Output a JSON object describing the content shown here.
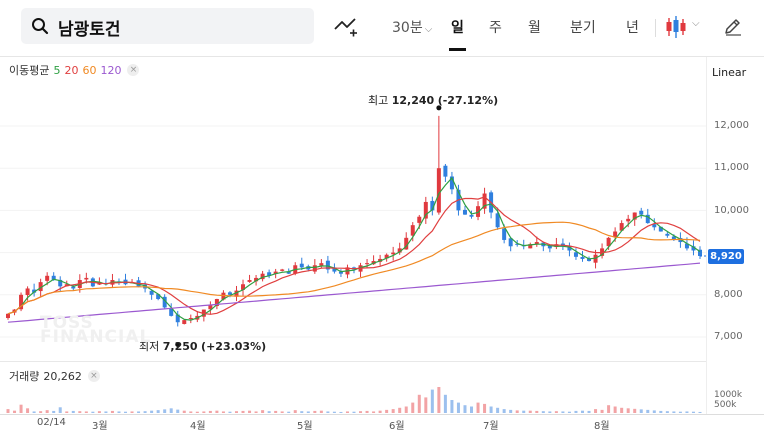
{
  "search": {
    "stock_name": "남광토건"
  },
  "toolbar": {
    "interval": "30분",
    "periods": [
      "일",
      "주",
      "월",
      "분기",
      "년"
    ],
    "active_period": "일"
  },
  "legend": {
    "ma_title": "이동평균",
    "ma_periods": [
      "5",
      "20",
      "60",
      "120"
    ],
    "ma_colors": [
      "#2ea043",
      "#e04040",
      "#f08a24",
      "#9b59d0"
    ],
    "close_symbol": "×",
    "scale": "Linear"
  },
  "colors": {
    "up": "#e0393e",
    "down": "#2f7fde",
    "price_tag": "#1e6fe0"
  },
  "price_axis": [
    "12,000",
    "11,000",
    "10,000",
    "9,000",
    "8,000",
    "7,000"
  ],
  "current_price": "8,920",
  "annotations": {
    "high_label": "최고",
    "high_value": "12,240",
    "high_change": "(-27.12%)",
    "low_label": "최저",
    "low_value": "7,250",
    "low_change": "(+23.03%)"
  },
  "watermark": [
    "TOSS",
    "FINANCIAL"
  ],
  "volume": {
    "title": "거래량",
    "value": "20,262",
    "axis": [
      "1000k",
      "500k"
    ]
  },
  "x_axis": [
    "02/14",
    "3월",
    "4월",
    "5월",
    "6월",
    "7월",
    "8월"
  ],
  "chart_data": {
    "type": "candlestick",
    "title": "남광토건",
    "ylim": [
      6700,
      12800
    ],
    "y_ticks": [
      7000,
      8000,
      9000,
      10000,
      11000,
      12000
    ],
    "high": 12240,
    "low": 7250,
    "current": 8920,
    "volume_last": 20262,
    "closes": [
      7550,
      7650,
      8000,
      8150,
      8050,
      8300,
      8450,
      8350,
      8200,
      8250,
      8150,
      8350,
      8400,
      8200,
      8300,
      8250,
      8350,
      8300,
      8250,
      8300,
      8200,
      8150,
      8000,
      7900,
      7700,
      7500,
      7350,
      7400,
      7450,
      7500,
      7650,
      7750,
      7900,
      8050,
      8000,
      8100,
      8250,
      8350,
      8400,
      8500,
      8450,
      8550,
      8600,
      8500,
      8700,
      8650,
      8600,
      8700,
      8750,
      8600,
      8550,
      8500,
      8650,
      8600,
      8700,
      8750,
      8800,
      8850,
      8950,
      9000,
      9100,
      9350,
      9650,
      9850,
      10200,
      10000,
      11000,
      10800,
      10500,
      10000,
      9900,
      9850,
      10100,
      10400,
      9950,
      9600,
      9300,
      9150,
      9200,
      9150,
      9200,
      9250,
      9150,
      9100,
      9200,
      9150,
      9050,
      8900,
      8850,
      8800,
      8950,
      9100,
      9350,
      9500,
      9700,
      9800,
      9950,
      9900,
      9700,
      9600,
      9500,
      9400,
      9300,
      9250,
      9100,
      9050,
      8920
    ],
    "volumes": [
      150,
      90,
      320,
      180,
      60,
      70,
      110,
      80,
      220,
      60,
      80,
      70,
      60,
      50,
      70,
      60,
      80,
      60,
      50,
      60,
      60,
      70,
      90,
      110,
      140,
      180,
      130,
      90,
      60,
      50,
      60,
      80,
      90,
      60,
      50,
      70,
      80,
      90,
      60,
      110,
      70,
      80,
      60,
      50,
      110,
      70,
      60,
      80,
      90,
      60,
      50,
      40,
      60,
      50,
      70,
      80,
      60,
      90,
      120,
      150,
      200,
      250,
      400,
      700,
      600,
      900,
      1000,
      700,
      500,
      400,
      300,
      250,
      400,
      350,
      250,
      200,
      150,
      120,
      100,
      90,
      90,
      80,
      70,
      60,
      70,
      60,
      50,
      80,
      90,
      80,
      150,
      120,
      300,
      250,
      200,
      180,
      160,
      140,
      120,
      100,
      80,
      70,
      60,
      50,
      60,
      50,
      40
    ],
    "series": [
      {
        "name": "5",
        "color": "#2ea043"
      },
      {
        "name": "20",
        "color": "#e04040"
      },
      {
        "name": "60",
        "color": "#f08a24"
      },
      {
        "name": "120",
        "color": "#9b59d0"
      }
    ]
  }
}
